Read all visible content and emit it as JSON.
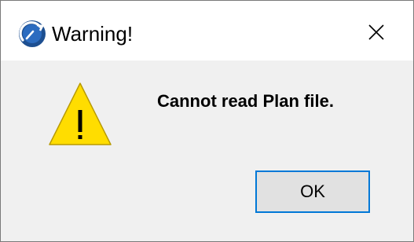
{
  "window": {
    "title": "Warning!",
    "app_icon": "archicad-logo-icon",
    "close_icon": "close-icon"
  },
  "dialog": {
    "icon": "warning-triangle-icon",
    "message": "Cannot read Plan file.",
    "ok_label": "OK"
  },
  "colors": {
    "accent": "#0078d7",
    "warning_fill": "#ffdd00",
    "titlebar_bg": "#ffffff",
    "body_bg": "#f0f0f0",
    "button_bg": "#e1e1e1",
    "app_icon_blue": "#1d4f91"
  }
}
